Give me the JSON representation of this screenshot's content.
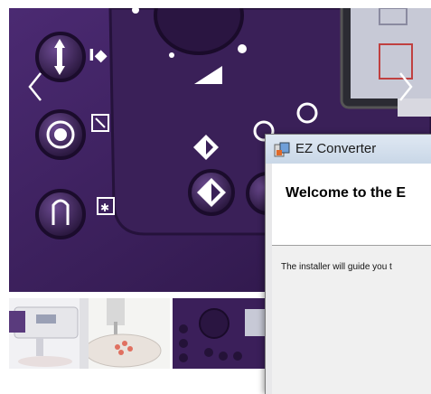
{
  "carousel": {
    "prev_symbol": "‹",
    "next_symbol": "›",
    "thumbnails": [
      "machine-front-view",
      "embroidery-hoop-closeup",
      "control-panel-closeup"
    ]
  },
  "dialog": {
    "title": "EZ Converter",
    "heading": "Welcome to the E",
    "description": "The installer will guide you t"
  },
  "colors": {
    "panel_purple": "#3b1f5a",
    "dialog_title_bg": "#c9d7e7"
  }
}
